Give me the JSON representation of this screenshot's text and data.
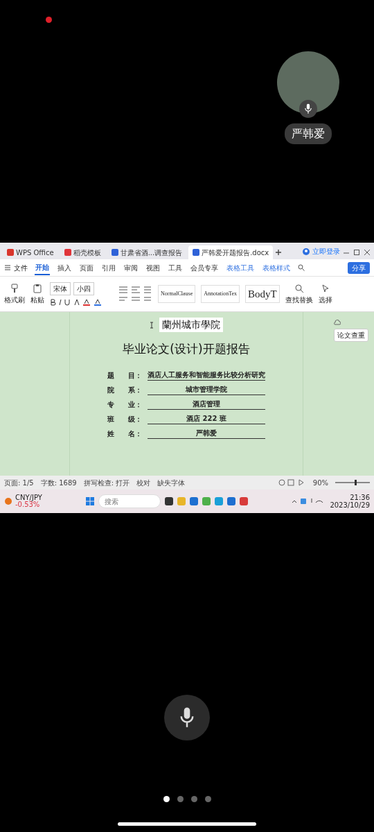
{
  "participant": {
    "name": "严韩爱"
  },
  "shared_screen": {
    "doc_tabs": [
      {
        "label": "WPS Office",
        "kind": "home",
        "selected": false
      },
      {
        "label": "稻壳模板",
        "kind": "template",
        "selected": false
      },
      {
        "label": "甘肃省酒...调查报告",
        "kind": "doc",
        "selected": false
      },
      {
        "label": "严韩爱开题报告.docx",
        "kind": "doc",
        "selected": true
      }
    ],
    "account": "立即登录",
    "file_menu": "文件",
    "ribbon_tabs": [
      {
        "label": "开始",
        "kind": "normal",
        "selected": true
      },
      {
        "label": "插入",
        "kind": "normal",
        "selected": false
      },
      {
        "label": "页面",
        "kind": "normal",
        "selected": false
      },
      {
        "label": "引用",
        "kind": "normal",
        "selected": false
      },
      {
        "label": "审阅",
        "kind": "normal",
        "selected": false
      },
      {
        "label": "视图",
        "kind": "normal",
        "selected": false
      },
      {
        "label": "工具",
        "kind": "normal",
        "selected": false
      },
      {
        "label": "会员专享",
        "kind": "normal",
        "selected": false
      },
      {
        "label": "表格工具",
        "kind": "contextual",
        "selected": false
      },
      {
        "label": "表格样式",
        "kind": "contextual",
        "selected": false
      }
    ],
    "share_button": "分享",
    "ribbon": {
      "format_painter": "格式刷",
      "paste": "粘贴",
      "font": "宋体",
      "font_size": "小四",
      "styles": [
        "NormalClause",
        "AnnotationTex",
        "BodyT"
      ],
      "find_replace": "查找替换",
      "select": "选择"
    },
    "document": {
      "school": "蘭州城市學院",
      "title": "毕业论文(设计)开题报告",
      "fields": [
        {
          "label": "题　　目：",
          "value": "酒店人工服务和智能服务比较分析研究"
        },
        {
          "label": "院　　系：",
          "value": "城市管理学院"
        },
        {
          "label": "专　　业：",
          "value": "酒店管理"
        },
        {
          "label": "班　　级：",
          "value": "酒店 222 班"
        },
        {
          "label": "姓　　名：",
          "value": "严韩爱"
        }
      ]
    },
    "side_panel": {
      "button": "论文查重"
    },
    "status_bar": {
      "items": [
        "页面: 1/5",
        "字数: 1689",
        "拼写检查: 打开",
        "校对",
        "缺失字体"
      ],
      "zoom": "90%",
      "zoom_slider": {
        "level": 0.55
      }
    },
    "taskbar": {
      "widget_title": "CNY/JPY",
      "widget_value": "-0.53%",
      "search_placeholder": "搜索",
      "time": "21:36",
      "date": "2023/10/29"
    }
  },
  "pager": [
    {
      "selected": true
    },
    {
      "selected": false
    },
    {
      "selected": false
    },
    {
      "selected": false
    }
  ]
}
